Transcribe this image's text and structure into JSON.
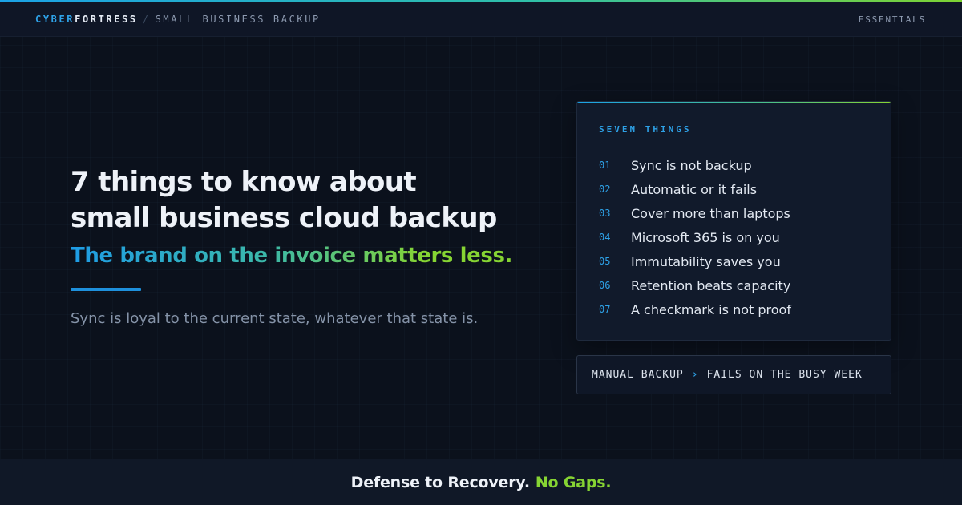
{
  "colors": {
    "background": "#0b111c",
    "accent_blue": "#2ea2e8",
    "accent_green": "#86d433"
  },
  "header": {
    "brand_primary": "CYBER",
    "brand_secondary": "FORTRESS",
    "separator": "/",
    "section": "SMALL BUSINESS BACKUP",
    "tag": "ESSENTIALS"
  },
  "hero": {
    "headline_line1": "7 things to know about",
    "headline_line2": "small business cloud backup",
    "subhead": "The brand on the invoice matters less.",
    "quote": "Sync is loyal to the current state, whatever that state is."
  },
  "panel": {
    "title": "SEVEN THINGS",
    "items": [
      {
        "num": "01",
        "label": "Sync is not backup"
      },
      {
        "num": "02",
        "label": "Automatic or it fails"
      },
      {
        "num": "03",
        "label": "Cover more than laptops"
      },
      {
        "num": "04",
        "label": "Microsoft 365 is on you"
      },
      {
        "num": "05",
        "label": "Immutability saves you"
      },
      {
        "num": "06",
        "label": "Retention beats capacity"
      },
      {
        "num": "07",
        "label": "A checkmark is not proof"
      }
    ]
  },
  "callout": {
    "left": "MANUAL BACKUP",
    "arrow": "›",
    "right": "FAILS ON THE BUSY WEEK"
  },
  "footer": {
    "part1": "Defense to Recovery.",
    "part2": "No Gaps."
  }
}
